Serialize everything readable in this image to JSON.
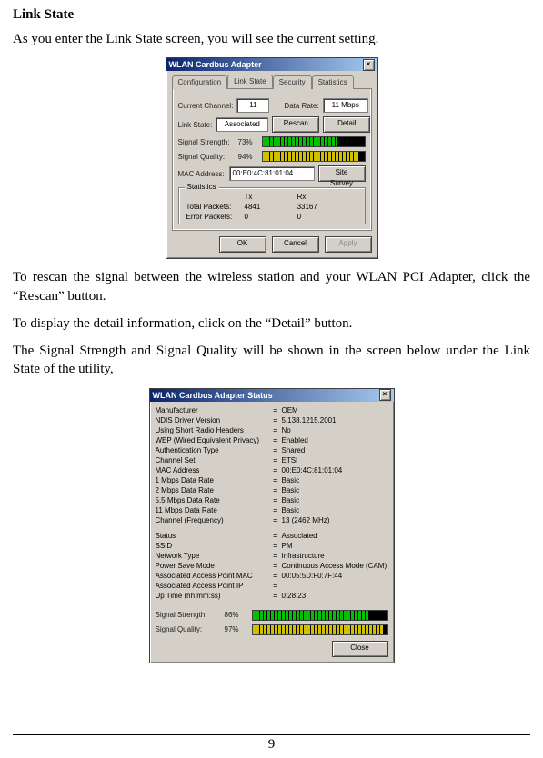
{
  "doc": {
    "heading": "Link State",
    "p1": "As you enter the Link State screen, you will see the current setting.",
    "p2": "To rescan the signal between the wireless station and your WLAN PCI Adapter, click the “Rescan” button.",
    "p3": "To display the detail information, click on the “Detail” button.",
    "p4": "The Signal Strength and Signal Quality will be shown in the screen below under the Link State of the utility,",
    "page_number": "9"
  },
  "dlg1": {
    "title": "WLAN Cardbus Adapter",
    "tabs": [
      "Configuration",
      "Link State",
      "Security",
      "Statistics"
    ],
    "active_tab": 1,
    "current_channel_label": "Current Channel:",
    "current_channel_value": "11",
    "data_rate_label": "Data Rate:",
    "data_rate_value": "11 Mbps",
    "link_state_label": "Link State:",
    "link_state_value": "Associated",
    "rescan_btn": "Rescan",
    "detail_btn": "Detail",
    "signal_strength_label": "Signal Strength:",
    "signal_strength_value": "73%",
    "signal_strength_pct": 73,
    "signal_quality_label": "Signal Quality:",
    "signal_quality_value": "94%",
    "signal_quality_pct": 94,
    "mac_label": "MAC Address:",
    "mac_value": "00:E0:4C:81:01:04",
    "site_survey_btn": "Site Survey",
    "stats_legend": "Statistics",
    "stats_cols": [
      "",
      "Tx",
      "Rx"
    ],
    "stats_rows": [
      {
        "label": "Total Packets:",
        "tx": "4841",
        "rx": "33167"
      },
      {
        "label": "Error Packets:",
        "tx": "0",
        "rx": "0"
      }
    ],
    "ok_btn": "OK",
    "cancel_btn": "Cancel",
    "apply_btn": "Apply"
  },
  "dlg2": {
    "title": "WLAN Cardbus Adapter Status",
    "kv": [
      {
        "k": "Manufacturer",
        "v": "OEM"
      },
      {
        "k": "NDIS Driver Version",
        "v": "5.138.1215.2001"
      },
      {
        "k": "Using Short Radio Headers",
        "v": "No"
      },
      {
        "k": "WEP (Wired Equivalent Privacy)",
        "v": "Enabled"
      },
      {
        "k": "Authentication Type",
        "v": "Shared"
      },
      {
        "k": "Channel Set",
        "v": "ETSI"
      },
      {
        "k": "MAC Address",
        "v": "00:E0:4C:81:01:04"
      },
      {
        "k": "1 Mbps Data Rate",
        "v": "Basic"
      },
      {
        "k": "2 Mbps Data Rate",
        "v": "Basic"
      },
      {
        "k": "5.5 Mbps Data Rate",
        "v": "Basic"
      },
      {
        "k": "11 Mbps Data Rate",
        "v": "Basic"
      },
      {
        "k": "Channel (Frequency)",
        "v": "13 (2462 MHz)"
      }
    ],
    "kv2": [
      {
        "k": "Status",
        "v": "Associated"
      },
      {
        "k": "SSID",
        "v": "PM"
      },
      {
        "k": "Network Type",
        "v": "Infrastructure"
      },
      {
        "k": "Power Save Mode",
        "v": "Continuous Access Mode (CAM)"
      },
      {
        "k": "Associated Access Point MAC",
        "v": "00:05:5D:F0:7F:44"
      },
      {
        "k": "Associated Access Point IP",
        "v": ""
      },
      {
        "k": "Up Time (hh:mm:ss)",
        "v": "0:28:23"
      }
    ],
    "signal_strength_label": "Signal Strength:",
    "signal_strength_value": "86%",
    "signal_strength_pct": 86,
    "signal_quality_label": "Signal Quality:",
    "signal_quality_value": "97%",
    "signal_quality_pct": 97,
    "close_btn": "Close"
  }
}
